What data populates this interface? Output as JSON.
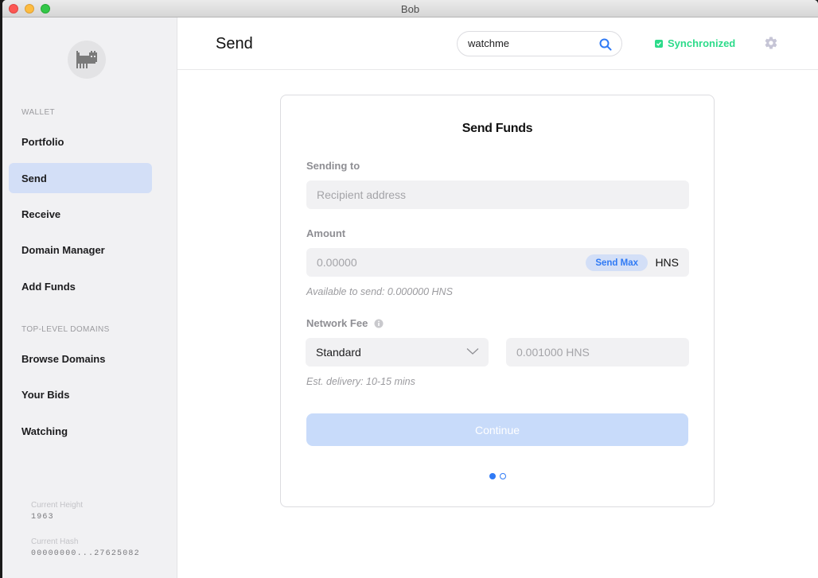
{
  "window": {
    "title": "Bob"
  },
  "sidebar": {
    "wallet_label": "WALLET",
    "wallet_items": [
      {
        "label": "Portfolio",
        "active": false
      },
      {
        "label": "Send",
        "active": true
      },
      {
        "label": "Receive",
        "active": false
      },
      {
        "label": "Domain Manager",
        "active": false
      },
      {
        "label": "Add Funds",
        "active": false
      }
    ],
    "tld_label": "TOP-LEVEL DOMAINS",
    "tld_items": [
      {
        "label": "Browse Domains"
      },
      {
        "label": "Your Bids"
      },
      {
        "label": "Watching"
      }
    ],
    "current_height_label": "Current Height",
    "current_height": "1963",
    "current_hash_label": "Current Hash",
    "current_hash": "00000000...27625082"
  },
  "header": {
    "title": "Send",
    "search_value": "watchme",
    "sync_status": "Synchronized"
  },
  "card": {
    "title": "Send Funds",
    "sending_to_label": "Sending to",
    "recipient_placeholder": "Recipient address",
    "amount_label": "Amount",
    "amount_placeholder": "0.00000",
    "send_max_label": "Send Max",
    "unit": "HNS",
    "available": "Available to send: 0.000000 HNS",
    "network_fee_label": "Network Fee",
    "fee_speed": "Standard",
    "fee_amount": "0.001000 HNS",
    "est_delivery": "Est. delivery: 10-15 mins",
    "continue_label": "Continue",
    "step_current": 1,
    "step_total": 2
  },
  "colors": {
    "accent": "#2f7af5",
    "sync_green": "#2cdb8a",
    "active_nav": "#d3dff7"
  }
}
